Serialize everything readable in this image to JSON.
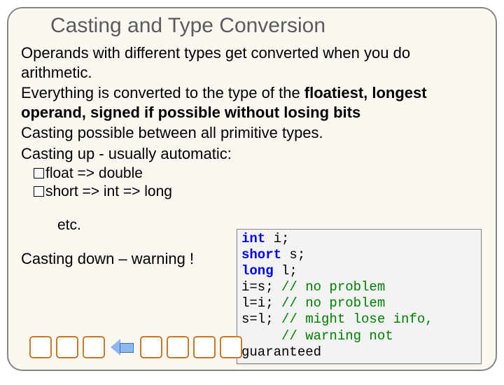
{
  "title": "Casting and Type Conversion",
  "para1_a": "Operands with different types get converted when you do arithmetic.",
  "para1_b_pre": "Everything is converted to the type of the ",
  "para1_b_bold": "floatiest, longest operand, signed if possible without losing bits",
  "para2": "Casting possible between all primitive types.",
  "para3": "Casting up - usually automatic:",
  "bullet1": "float => double",
  "bullet2": "short => int => long",
  "etc": "etc.",
  "castdown": "Casting down – warning !",
  "code": {
    "l1_kw": "int",
    "l1_r": " i;",
    "l2_kw": "short",
    "l2_r": " s;",
    "l3_kw": "long",
    "l3_r": " l;",
    "l4_a": "i=s; ",
    "l4_c": "// no problem",
    "l5_a": "l=i; ",
    "l5_c": "// no problem",
    "l6_a": "s=l; ",
    "l6_c": "// might lose info,",
    "l7_c": "     // warning not",
    "l8": "guaranteed"
  }
}
